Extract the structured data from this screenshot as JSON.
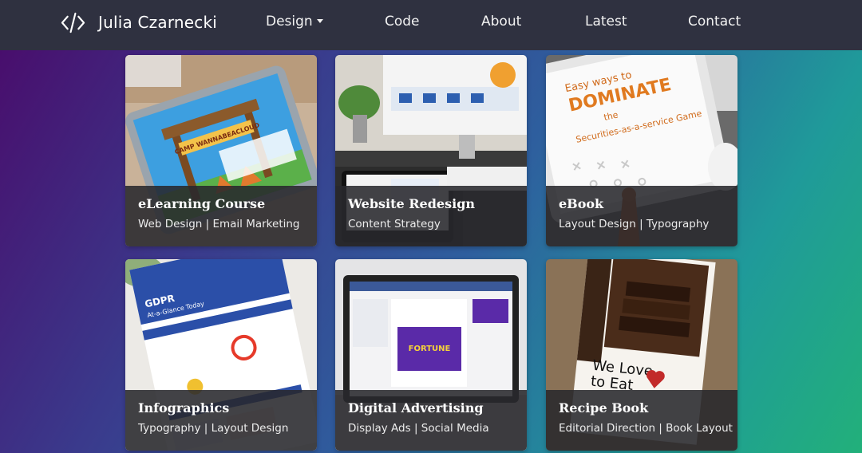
{
  "brand": {
    "name": "Julia Czarnecki",
    "icon": "code-icon"
  },
  "nav": {
    "design": "Design",
    "code": "Code",
    "about": "About",
    "latest": "Latest",
    "contact": "Contact"
  },
  "cards": [
    {
      "title": "eLearning Course",
      "subtitle": "Web Design | Email Marketing",
      "image_text": "CAMP WANNABEACLOUD"
    },
    {
      "title": "Website Redesign",
      "subtitle": "Content Strategy"
    },
    {
      "title": "eBook",
      "subtitle": "Layout Design | Typography",
      "image_text": "Easy ways to DOMINATE the Securities-as-a-service Game"
    },
    {
      "title": "Infographics",
      "subtitle": "Typography | Layout Design",
      "image_text": "GDPR At-a-Glance Today"
    },
    {
      "title": "Digital Advertising",
      "subtitle": "Display Ads | Social Media"
    },
    {
      "title": "Recipe Book",
      "subtitle": "Editorial Direction | Book Layout",
      "image_text": "We Love to Eat"
    }
  ],
  "colors": {
    "navbar": "#2f3140",
    "overlay": "#28282c",
    "gradient_start": "#4a0a6a",
    "gradient_end": "#22b07a"
  }
}
